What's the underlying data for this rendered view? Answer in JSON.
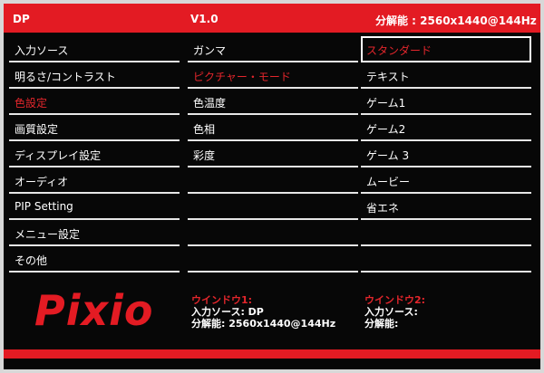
{
  "header": {
    "input": "DP",
    "version": "V1.0",
    "resolution": "分解能 : 2560x1440@144Hz"
  },
  "main_menu": [
    {
      "label": "入力ソース"
    },
    {
      "label": "明るさ/コントラスト"
    },
    {
      "label": "色設定",
      "active": true
    },
    {
      "label": "画質設定"
    },
    {
      "label": "ディスプレイ設定"
    },
    {
      "label": "オーディオ"
    },
    {
      "label": "PIP Setting"
    },
    {
      "label": "メニュー設定"
    },
    {
      "label": "その他"
    }
  ],
  "sub_menu": [
    {
      "label": "ガンマ"
    },
    {
      "label": "ピクチャー・モード",
      "active": true
    },
    {
      "label": "色温度"
    },
    {
      "label": "色相"
    },
    {
      "label": "彩度"
    },
    {
      "label": ""
    },
    {
      "label": ""
    },
    {
      "label": ""
    },
    {
      "label": ""
    }
  ],
  "options": [
    {
      "label": "スタンダード",
      "selected": true
    },
    {
      "label": "テキスト"
    },
    {
      "label": "ゲーム1"
    },
    {
      "label": "ゲーム2"
    },
    {
      "label": "ゲーム 3"
    },
    {
      "label": "ムービー"
    },
    {
      "label": "省エネ"
    },
    {
      "label": ""
    },
    {
      "label": ""
    }
  ],
  "brand": "Pixio",
  "window1": {
    "title": "ウインドウ1:",
    "input": "入力ソース:   DP",
    "resolution": "分解能:  2560x1440@144Hz"
  },
  "window2": {
    "title": "ウインドウ2:",
    "input": "入力ソース:",
    "resolution": "分解能:"
  },
  "colors": {
    "accent": "#e31b23",
    "background": "#070707",
    "text": "#ffffff",
    "highlight_text": "#e3262c"
  }
}
